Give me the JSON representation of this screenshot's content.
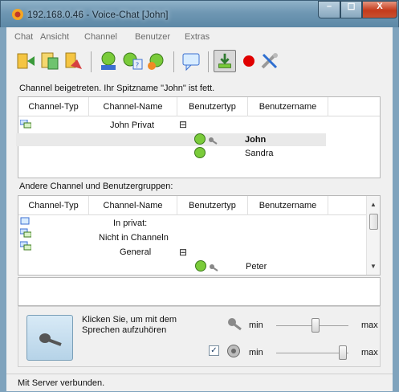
{
  "window": {
    "title": "192.168.0.46 - Voice-Chat [John]",
    "controls": {
      "minimize": "–",
      "maximize": "☐",
      "close": "X"
    }
  },
  "menu": [
    "Chat",
    "Ansicht",
    "Channel",
    "Benutzer",
    "Extras"
  ],
  "status_top": "Channel beigetreten. Ihr Spitzname \"John\" ist fett.",
  "columns": {
    "channel_type": "Channel-Typ",
    "channel_name": "Channel-Name",
    "user_type": "Benutzertyp",
    "username": "Benutzername"
  },
  "current_channel": {
    "name": "John Privat",
    "collapse": "⊟",
    "users": [
      "John",
      "Sandra"
    ]
  },
  "others_label": "Andere Channel und Benutzergruppen:",
  "other_channels": {
    "rows": [
      "In privat:",
      "Nicht in Channeln",
      "General"
    ],
    "collapse": "⊟",
    "users": [
      "Peter"
    ]
  },
  "talk": {
    "text": "Klicken Sie, um mit dem Sprechen aufzuhören"
  },
  "sliders": {
    "min": "min",
    "max": "max",
    "mic_level": 0.55,
    "speaker_level": 0.97,
    "speaker_enabled_mark": "✓"
  },
  "statusbar": "Mit Server verbunden.",
  "colors": {
    "accent": "#7fa3bd",
    "record": "#e00000"
  }
}
